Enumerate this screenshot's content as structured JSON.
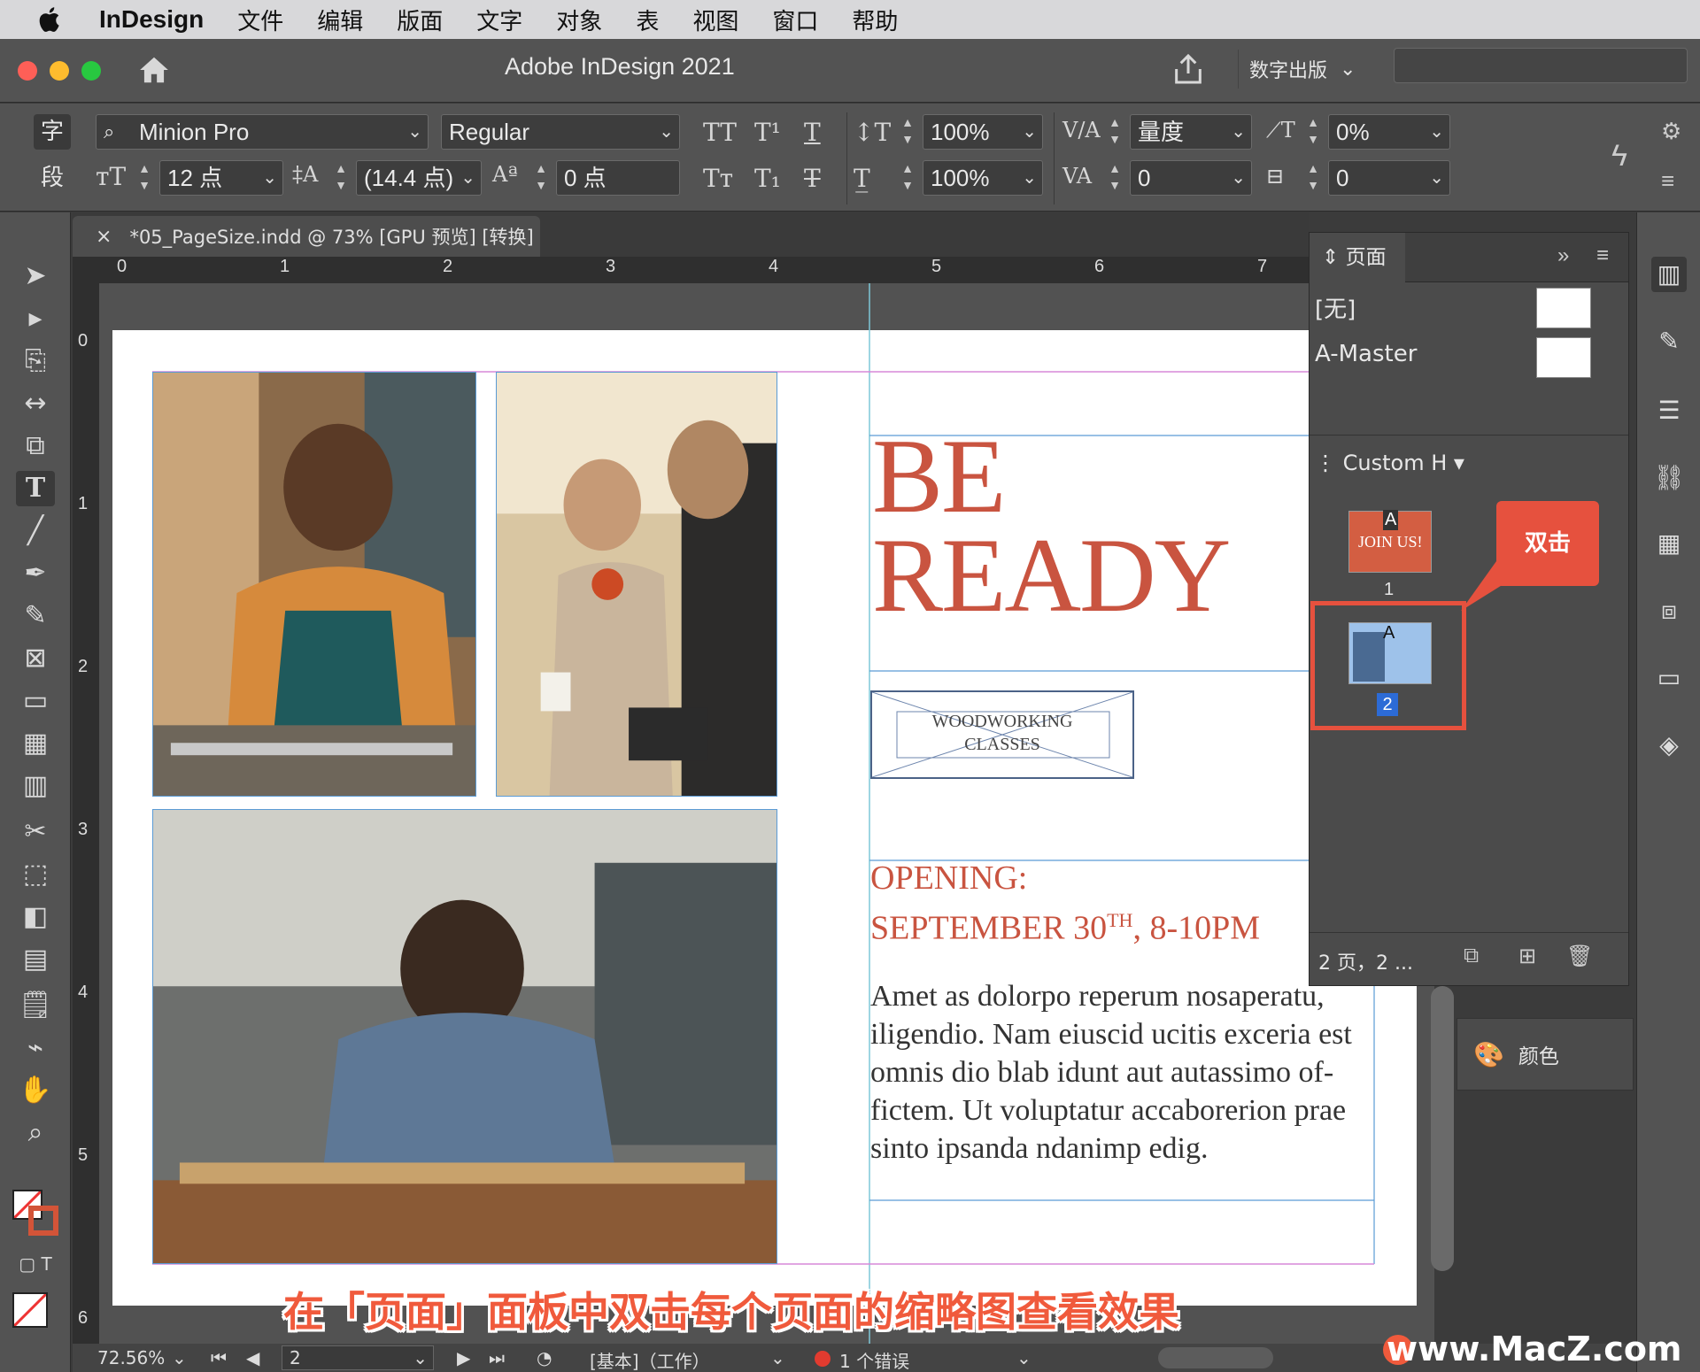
{
  "menubar": {
    "app_name": "InDesign",
    "items": [
      "文件",
      "编辑",
      "版面",
      "文字",
      "对象",
      "表",
      "视图",
      "窗口",
      "帮助"
    ]
  },
  "titlebar": {
    "title": "Adobe InDesign 2021",
    "workspace": "数字出版"
  },
  "control": {
    "char_mode": "字",
    "para_mode": "段",
    "font_family": "Minion Pro",
    "font_style": "Regular",
    "font_size": "12 点",
    "leading": "(14.4 点)",
    "baseline_shift": "0 点",
    "vertical_scale": "100%",
    "horizontal_scale": "100%",
    "kerning": "量度",
    "tracking": "0",
    "skew": "0%",
    "char_rotation": "0"
  },
  "document_tab": {
    "close": "×",
    "label": "*05_PageSize.indd @ 73% [GPU 预览] [转换]"
  },
  "ruler": {
    "h_numbers": [
      "0",
      "1",
      "2",
      "3",
      "4",
      "5",
      "6",
      "7"
    ],
    "v_numbers": [
      "0",
      "1",
      "2",
      "3",
      "4",
      "5",
      "6"
    ]
  },
  "document": {
    "headline_line1": "BE",
    "headline_line2": "READY",
    "logo_line1": "WOODWORKING",
    "logo_line2": "CLASSES",
    "opening_line1": "OPENING:",
    "opening_line2_a": "SEPTEMBER 30",
    "opening_sup": "TH",
    "opening_line2_b": ", 8-10PM",
    "body_lines": [
      "Amet as dolorpo reperum nosaperatu,",
      "iligendio. Nam eiuscid ucitis exceria est",
      "omnis dio blab idunt aut autassimo of-",
      "fictem. Ut voluptatur accaborerion prae",
      "sinto ipsanda ndanimp edig."
    ]
  },
  "pages_panel": {
    "tab_label": "页面",
    "masters": [
      "[无]",
      "A-Master"
    ],
    "size_selector": "Custom H",
    "page1": {
      "number": "1",
      "master_letter": "A",
      "thumb_text": "JOIN US!"
    },
    "page2": {
      "number": "2",
      "master_letter": "A"
    },
    "footer": "2 页，2 ..."
  },
  "callout": "双击",
  "color_panel": "颜色",
  "status": {
    "zoom": "72.56%",
    "page": "2",
    "preflight_profile": "[基本]（工作）",
    "errors": "1 个错误"
  },
  "subtitle": "在「页面」面板中双击每个页面的缩略图查看效果",
  "watermark": "www.MacZ.com",
  "colors": {
    "accent_red": "#c95440",
    "callout_red": "#e6513e",
    "guide_blue": "#5b9bd5",
    "panel_bg": "#535353"
  }
}
